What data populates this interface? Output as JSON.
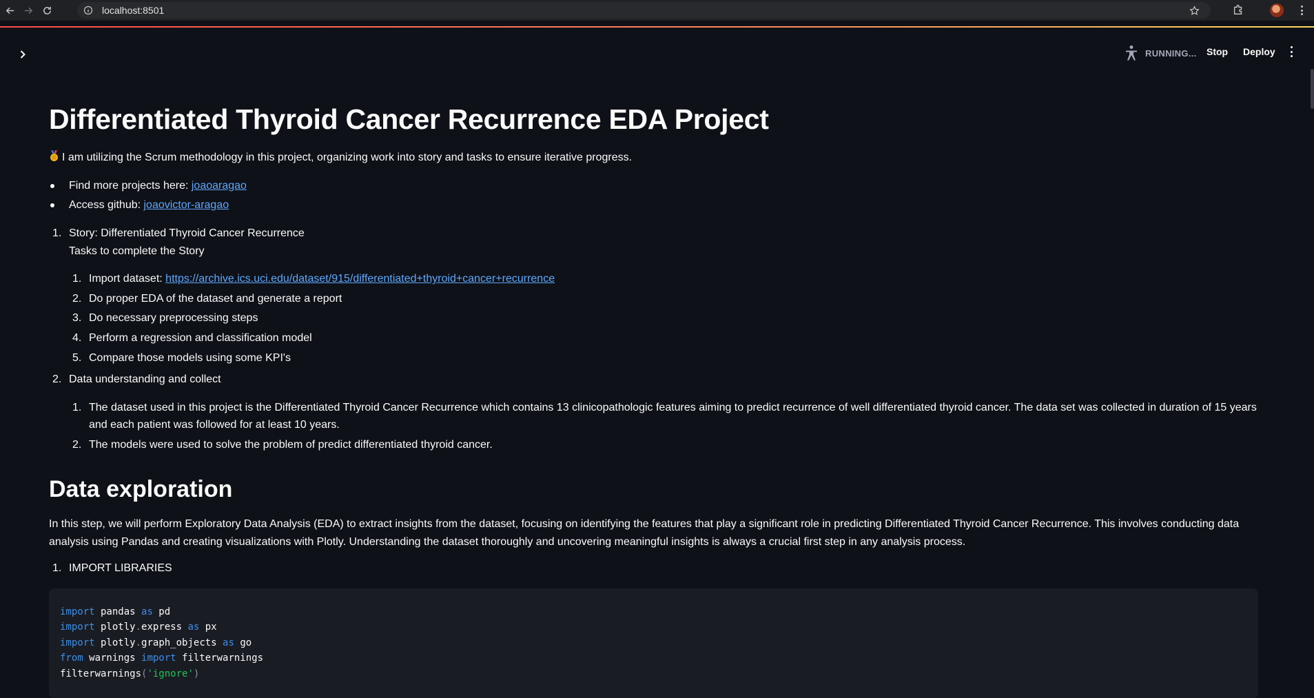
{
  "browser": {
    "url": "localhost:8501"
  },
  "header": {
    "status_label": "RUNNING...",
    "stop_label": "Stop",
    "deploy_label": "Deploy"
  },
  "main": {
    "title": "Differentiated Thyroid Cancer Recurrence EDA Project",
    "intro": "I am utilizing the Scrum methodology in this project, organizing work into story and tasks to ensure iterative progress.",
    "links": [
      {
        "prefix": "Find more projects here: ",
        "text": "joaoaragao"
      },
      {
        "prefix": "Access github: ",
        "text": "joaovictor-aragao"
      }
    ],
    "story": {
      "number": "1.",
      "title": "Story: Differentiated Thyroid Cancer Recurrence",
      "subtitle": "Tasks to complete the Story",
      "tasks": [
        {
          "number": "1.",
          "prefix": "Import dataset: ",
          "link": "https://archive.ics.uci.edu/dataset/915/differentiated+thyroid+cancer+recurrence"
        },
        {
          "number": "2.",
          "text": "Do proper EDA of the dataset and generate a report"
        },
        {
          "number": "3.",
          "text": "Do necessary preprocessing steps"
        },
        {
          "number": "4.",
          "text": "Perform a regression and classification model"
        },
        {
          "number": "5.",
          "text": "Compare those models using some KPI's"
        }
      ]
    },
    "understanding": {
      "number": "2.",
      "title": "Data understanding and collect",
      "items": [
        {
          "number": "1.",
          "text": "The dataset used in this project is the Differentiated Thyroid Cancer Recurrence which contains 13 clinicopathologic features aiming to predict recurrence of well differentiated thyroid cancer. The data set was collected in duration of 15 years and each patient was followed for at least 10 years."
        },
        {
          "number": "2.",
          "text": "The models were used to solve the problem of predict differentiated thyroid cancer."
        }
      ]
    },
    "exploration": {
      "title": "Data exploration",
      "intro": "In this step, we will perform Exploratory Data Analysis (EDA) to extract insights from the dataset, focusing on identifying the features that play a significant role in predicting Differentiated Thyroid Cancer Recurrence. This involves conducting data analysis using Pandas and creating visualizations with Plotly. Understanding the dataset thoroughly and uncovering meaningful insights is always a crucial first step in any analysis process.",
      "step_number": "1.",
      "step_label": "IMPORT LIBRARIES"
    },
    "code": {
      "lines": [
        "import pandas as pd",
        "import plotly.express as px",
        "import plotly.graph_objects as go",
        "from warnings import filterwarnings",
        "filterwarnings('ignore')"
      ]
    }
  },
  "colors": {
    "background": "#0e1117",
    "link": "#5fa8ff",
    "code_background": "#1a1c24",
    "keyword": "#3b8ee8",
    "string": "#21c354"
  },
  "icons": [
    "back-icon",
    "forward-icon",
    "reload-icon",
    "info-icon",
    "star-icon",
    "extensions-icon",
    "profile-avatar",
    "browser-menu-icon",
    "chevron-right-icon",
    "running-icon",
    "main-menu-icon",
    "medal-icon"
  ]
}
